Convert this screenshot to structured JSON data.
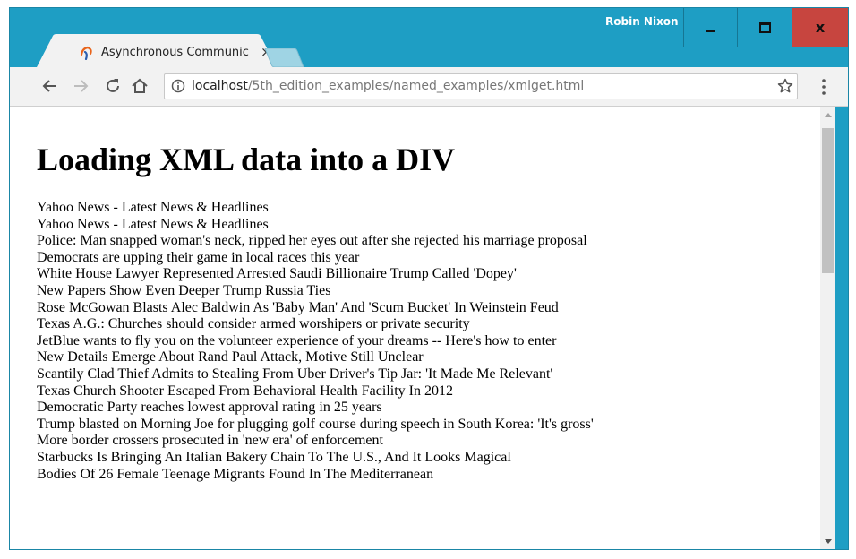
{
  "window": {
    "user_name": "Robin Nixon",
    "accent_color": "#1e9ec4",
    "close_button_color": "#c7453f",
    "close_glyph": "x"
  },
  "tab": {
    "title": "Asynchronous Communic",
    "close_glyph": "×",
    "favicon": "xampp-icon"
  },
  "toolbar": {
    "url_host": "localhost",
    "url_path": "/5th_edition_examples/named_examples/xmlget.html",
    "icons": [
      "back-icon",
      "forward-icon",
      "reload-icon",
      "home-icon",
      "info-icon",
      "star-icon",
      "menu-icon"
    ]
  },
  "page": {
    "title": "Loading XML data into a DIV",
    "items": [
      "Yahoo News - Latest News & Headlines",
      "Yahoo News - Latest News & Headlines",
      "Police: Man snapped woman's neck, ripped her eyes out after she rejected his marriage proposal",
      "Democrats are upping their game in local races this year",
      "White House Lawyer Represented Arrested Saudi Billionaire Trump Called 'Dopey'",
      "New Papers Show Even Deeper Trump Russia Ties",
      "Rose McGowan Blasts Alec Baldwin As 'Baby Man' And 'Scum Bucket' In Weinstein Feud",
      "Texas A.G.: Churches should consider armed worshipers or private security",
      "JetBlue wants to fly you on the volunteer experience of your dreams -- Here's how to enter",
      "New Details Emerge About Rand Paul Attack, Motive Still Unclear",
      "Scantily Clad Thief Admits to Stealing From Uber Driver's Tip Jar: 'It Made Me Relevant'",
      "Texas Church Shooter Escaped From Behavioral Health Facility In 2012",
      "Democratic Party reaches lowest approval rating in 25 years",
      "Trump blasted on Morning Joe for plugging golf course during speech in South Korea: 'It's gross'",
      "More border crossers prosecuted in 'new era' of enforcement",
      "Starbucks Is Bringing An Italian Bakery Chain To The U.S., And It Looks Magical",
      "Bodies Of 26 Female Teenage Migrants Found In The Mediterranean"
    ]
  }
}
